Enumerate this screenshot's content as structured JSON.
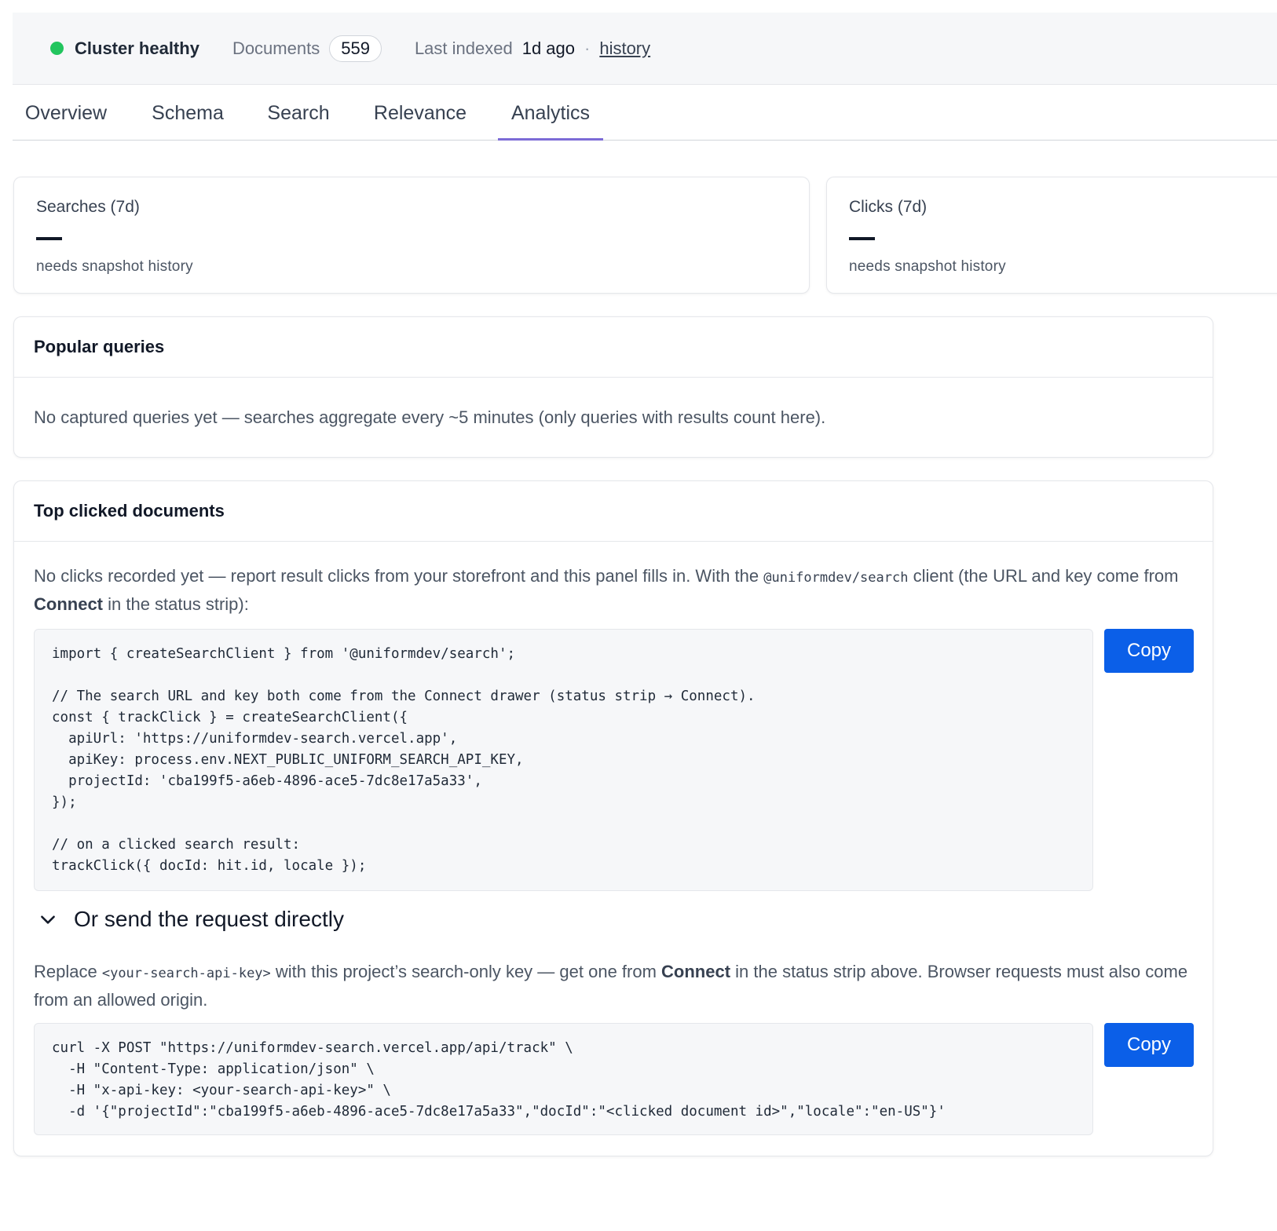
{
  "status": {
    "health": "Cluster healthy",
    "health_color": "#22c55e",
    "documents_label": "Documents",
    "documents_count": "559",
    "last_indexed_label": "Last indexed",
    "last_indexed_value": "1d ago",
    "separator": "·",
    "history_link": "history"
  },
  "tabs": [
    "Overview",
    "Schema",
    "Search",
    "Relevance",
    "Analytics"
  ],
  "active_tab": "Analytics",
  "stats": {
    "searches": {
      "title": "Searches (7d)",
      "value": "—",
      "sub": "needs snapshot history"
    },
    "clicks": {
      "title": "Clicks (7d)",
      "value": "—",
      "sub": "needs snapshot history"
    }
  },
  "popular": {
    "title": "Popular queries",
    "empty": "No captured queries yet — searches aggregate every ~5 minutes (only queries with results count here)."
  },
  "top_clicked": {
    "title": "Top clicked documents",
    "intro_1": "No clicks recorded yet — report result clicks from your storefront and this panel fills in. With the ",
    "intro_code": "@uniformdev/search",
    "intro_2": " client (the URL and key come from ",
    "intro_bold": "Connect",
    "intro_3": " in the status strip):",
    "code_1": "import { createSearchClient } from '@uniformdev/search';\n\n// The search URL and key both come from the Connect drawer (status strip → Connect).\nconst { trackClick } = createSearchClient({\n  apiUrl: 'https://uniformdev-search.vercel.app',\n  apiKey: process.env.NEXT_PUBLIC_UNIFORM_SEARCH_API_KEY,\n  projectId: 'cba199f5-a6eb-4896-ace5-7dc8e17a5a33',\n});\n\n// on a clicked search result:\ntrackClick({ docId: hit.id, locale });",
    "copy_label": "Copy",
    "disclosure_icon": "chevron-down-icon",
    "disclosure_label": "Or send the request directly",
    "replace_1": "Replace ",
    "replace_code": "<your-search-api-key>",
    "replace_2": " with this project’s search-only key — get one from ",
    "replace_bold": "Connect",
    "replace_3": " in the status strip above. Browser requests must also come from an allowed origin.",
    "code_2": "curl -X POST \"https://uniformdev-search.vercel.app/api/track\" \\\n  -H \"Content-Type: application/json\" \\\n  -H \"x-api-key: <your-search-api-key>\" \\\n  -d '{\"projectId\":\"cba199f5-a6eb-4896-ace5-7dc8e17a5a33\",\"docId\":\"<clicked document id>\",\"locale\":\"en-US\"}'"
  },
  "colors": {
    "accent": "#0b5fe8",
    "tab_underline": "#7c6bd6"
  }
}
